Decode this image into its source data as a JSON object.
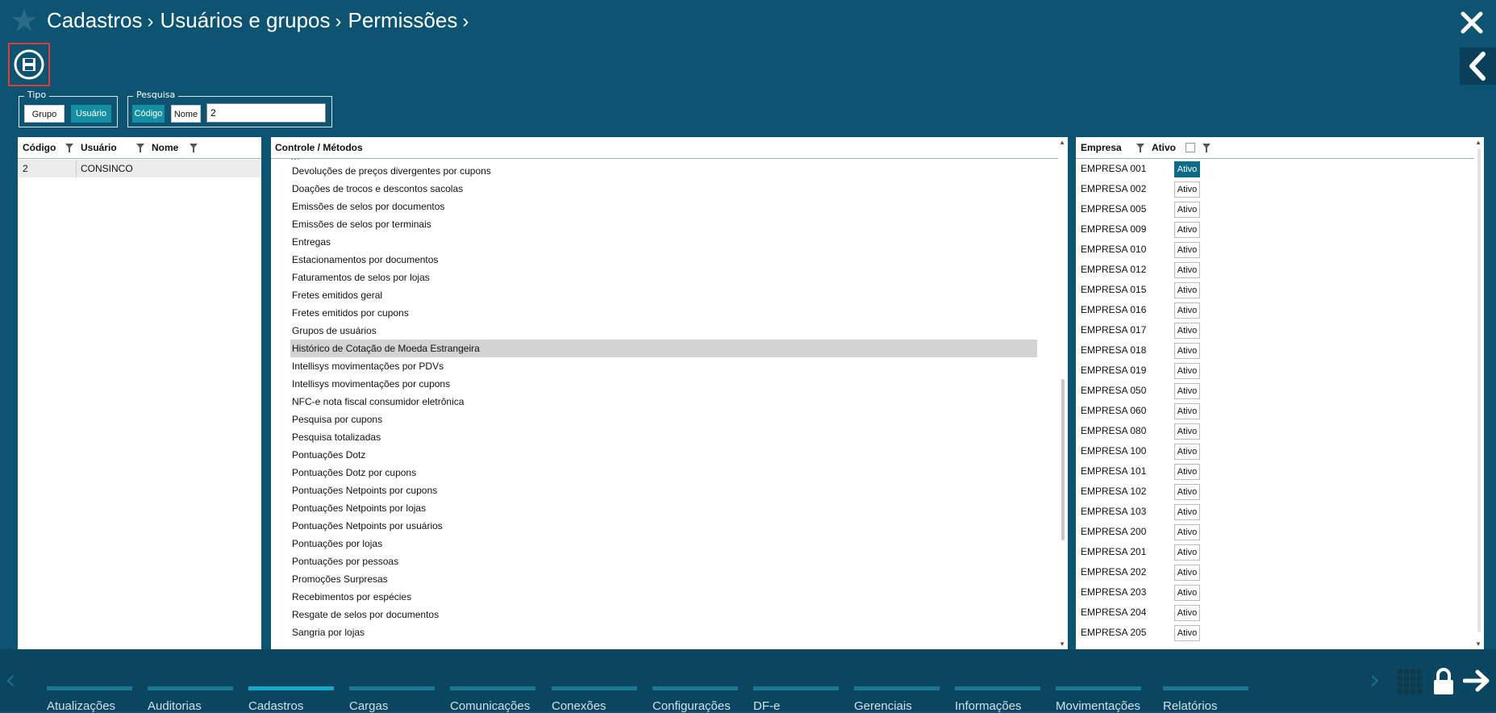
{
  "header": {
    "breadcrumb": [
      "Cadastros",
      "Usuários e grupos",
      "Permissões"
    ],
    "separator": "›"
  },
  "tipo": {
    "legend": "Tipo",
    "grupo_label": "Grupo",
    "usuario_label": "Usuário",
    "active": "Usuário"
  },
  "pesquisa": {
    "legend": "Pesquisa",
    "codigo_label": "Código",
    "nome_label": "Nome",
    "value": "2",
    "active": "Código"
  },
  "users_table": {
    "columns": [
      "Código",
      "Usuário",
      "Nome"
    ],
    "rows": [
      {
        "codigo": "2",
        "usuario": "CONSINCO",
        "nome": ""
      }
    ]
  },
  "methods_panel": {
    "header": "Controle / Métodos",
    "selected": "Histórico de Cotação de Moeda Estrangeira",
    "items": [
      "Devoluções de preços divergentes por cupons",
      "Doações de trocos e descontos sacolas",
      "Emissões de selos por documentos",
      "Emissões de selos por terminais",
      "Entregas",
      "Estacionamentos por documentos",
      "Faturamentos de selos por lojas",
      "Fretes emitidos geral",
      "Fretes emitidos por cupons",
      "Grupos de usuários",
      "Histórico de Cotação de Moeda Estrangeira",
      "Intellisys movimentações por PDVs",
      "Intellisys movimentações por cupons",
      "NFC-e nota fiscal consumidor eletrônica",
      "Pesquisa por cupons",
      "Pesquisa totalizadas",
      "Pontuações Dotz",
      "Pontuações Dotz por cupons",
      "Pontuações Netpoints por cupons",
      "Pontuações Netpoints por lojas",
      "Pontuações Netpoints por usuários",
      "Pontuações por lojas",
      "Pontuações por pessoas",
      "Promoções Surpresas",
      "Recebimentos por espécies",
      "Resgate de selos por documentos",
      "Sangria por lojas"
    ]
  },
  "empresas_panel": {
    "columns": [
      "Empresa",
      "Ativo"
    ],
    "ativo_label": "Ativo",
    "rows": [
      {
        "empresa": "EMPRESA 001",
        "ativo": true
      },
      {
        "empresa": "EMPRESA 002",
        "ativo": false
      },
      {
        "empresa": "EMPRESA 005",
        "ativo": false
      },
      {
        "empresa": "EMPRESA 009",
        "ativo": false
      },
      {
        "empresa": "EMPRESA 010",
        "ativo": false
      },
      {
        "empresa": "EMPRESA 012",
        "ativo": false
      },
      {
        "empresa": "EMPRESA 015",
        "ativo": false
      },
      {
        "empresa": "EMPRESA 016",
        "ativo": false
      },
      {
        "empresa": "EMPRESA 017",
        "ativo": false
      },
      {
        "empresa": "EMPRESA 018",
        "ativo": false
      },
      {
        "empresa": "EMPRESA 019",
        "ativo": false
      },
      {
        "empresa": "EMPRESA 050",
        "ativo": false
      },
      {
        "empresa": "EMPRESA 060",
        "ativo": false
      },
      {
        "empresa": "EMPRESA 080",
        "ativo": false
      },
      {
        "empresa": "EMPRESA 100",
        "ativo": false
      },
      {
        "empresa": "EMPRESA 101",
        "ativo": false
      },
      {
        "empresa": "EMPRESA 102",
        "ativo": false
      },
      {
        "empresa": "EMPRESA 103",
        "ativo": false
      },
      {
        "empresa": "EMPRESA 200",
        "ativo": false
      },
      {
        "empresa": "EMPRESA 201",
        "ativo": false
      },
      {
        "empresa": "EMPRESA 202",
        "ativo": false
      },
      {
        "empresa": "EMPRESA 203",
        "ativo": false
      },
      {
        "empresa": "EMPRESA 204",
        "ativo": false
      },
      {
        "empresa": "EMPRESA 205",
        "ativo": false
      }
    ]
  },
  "footer_nav": {
    "active": "Cadastros",
    "items": [
      "Atualizações",
      "Auditorias",
      "Cadastros",
      "Cargas",
      "Comunicações",
      "Conexões",
      "Configurações",
      "DF-e",
      "Gerenciais",
      "Informações",
      "Movimentações",
      "Relatórios"
    ]
  },
  "icons": {
    "star": "star-icon",
    "close": "close-icon",
    "back": "chevron-left-icon",
    "save": "save-icon",
    "filter": "filter-icon",
    "grid": "grid-icon",
    "lock": "lock-icon",
    "exit": "arrow-right-icon"
  },
  "colors": {
    "background": "#0d5372",
    "footer": "#0a4660",
    "accent": "#1590a3",
    "highlight_box": "#e53935"
  }
}
